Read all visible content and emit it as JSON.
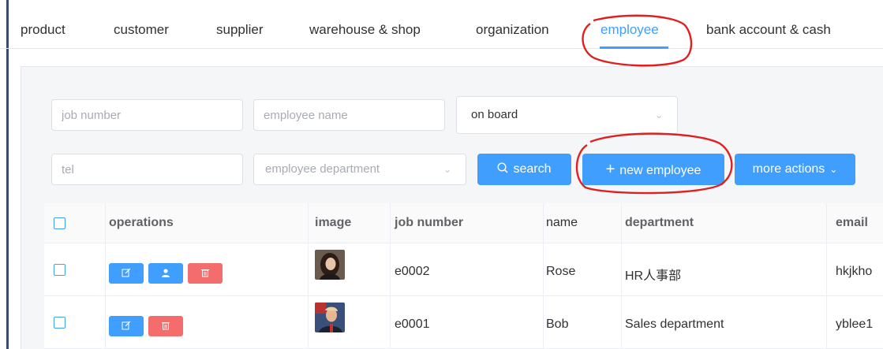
{
  "tabs": [
    {
      "label": "product"
    },
    {
      "label": "customer"
    },
    {
      "label": "supplier"
    },
    {
      "label": "warehouse & shop"
    },
    {
      "label": "organization"
    },
    {
      "label": "employee",
      "active": true
    },
    {
      "label": "bank account & cash"
    }
  ],
  "filters": {
    "job_number_placeholder": "job number",
    "employee_name_placeholder": "employee name",
    "status_selected": "on board",
    "tel_placeholder": "tel",
    "department_placeholder": "employee department"
  },
  "actions": {
    "search_label": "search",
    "new_employee_label": "new employee",
    "more_actions_label": "more actions"
  },
  "table": {
    "headers": {
      "operations": "operations",
      "image": "image",
      "job_number": "job number",
      "name": "name",
      "department": "department",
      "email": "email"
    },
    "rows": [
      {
        "job_number": "e0002",
        "name": "Rose",
        "department": "HR人事部",
        "email": "hkjkho",
        "ops": [
          "edit-icon",
          "user-icon",
          "delete-icon"
        ]
      },
      {
        "job_number": "e0001",
        "name": "Bob",
        "department": "Sales department",
        "email": "yblee1",
        "ops": [
          "edit-icon",
          "delete-icon"
        ]
      }
    ]
  },
  "colors": {
    "accent": "#409eff",
    "danger": "#f56c6c",
    "annotation": "#e0201f"
  }
}
